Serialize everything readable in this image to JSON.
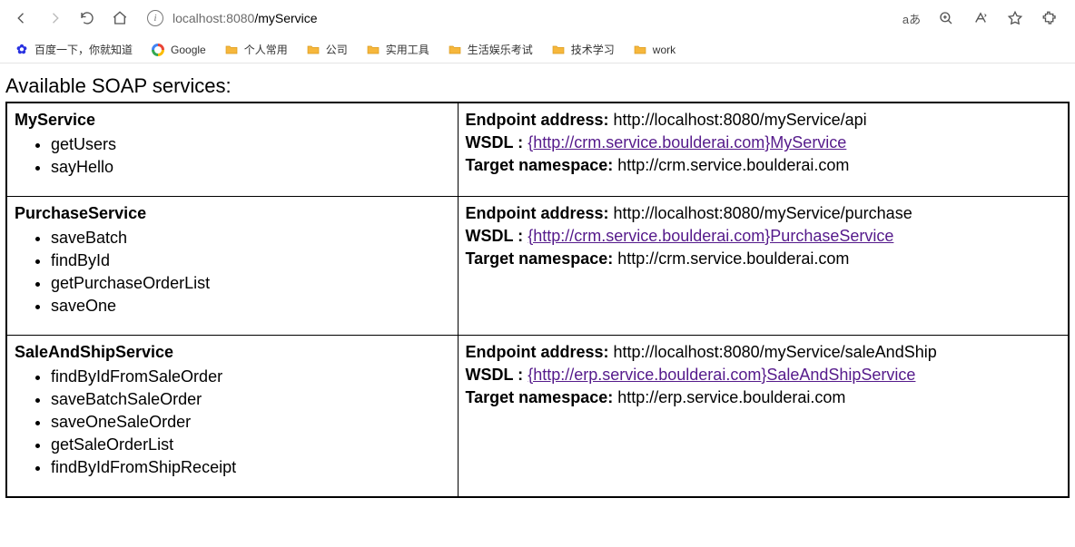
{
  "browser": {
    "url_host": "localhost",
    "url_port": ":8080",
    "url_path": "/myService",
    "aA_label": "aあ",
    "bookmarks": [
      {
        "id": "baidu",
        "label": "百度一下，你就知道",
        "icon": "baidu"
      },
      {
        "id": "google",
        "label": "Google",
        "icon": "google"
      },
      {
        "id": "personal",
        "label": "个人常用",
        "icon": "folder"
      },
      {
        "id": "company",
        "label": "公司",
        "icon": "folder"
      },
      {
        "id": "tools",
        "label": "实用工具",
        "icon": "folder"
      },
      {
        "id": "life",
        "label": "生活娱乐考试",
        "icon": "folder"
      },
      {
        "id": "tech",
        "label": "技术学习",
        "icon": "folder"
      },
      {
        "id": "work",
        "label": "work",
        "icon": "folder"
      }
    ]
  },
  "page": {
    "title": "Available SOAP services:",
    "labels": {
      "endpoint": "Endpoint address:",
      "wsdl": "WSDL :",
      "tns": "Target namespace:"
    },
    "services": [
      {
        "name": "MyService",
        "operations": [
          "getUsers",
          "sayHello"
        ],
        "endpoint": "http://localhost:8080/myService/api",
        "wsdl_text": "{http://crm.service.boulderai.com}MyService",
        "tns": "http://crm.service.boulderai.com"
      },
      {
        "name": "PurchaseService",
        "operations": [
          "saveBatch",
          "findById",
          "getPurchaseOrderList",
          "saveOne"
        ],
        "endpoint": "http://localhost:8080/myService/purchase",
        "wsdl_text": "{http://crm.service.boulderai.com}PurchaseService",
        "tns": "http://crm.service.boulderai.com"
      },
      {
        "name": "SaleAndShipService",
        "operations": [
          "findByIdFromSaleOrder",
          "saveBatchSaleOrder",
          "saveOneSaleOrder",
          "getSaleOrderList",
          "findByIdFromShipReceipt"
        ],
        "endpoint": "http://localhost:8080/myService/saleAndShip",
        "wsdl_text": "{http://erp.service.boulderai.com}SaleAndShipService",
        "tns": "http://erp.service.boulderai.com"
      }
    ]
  }
}
